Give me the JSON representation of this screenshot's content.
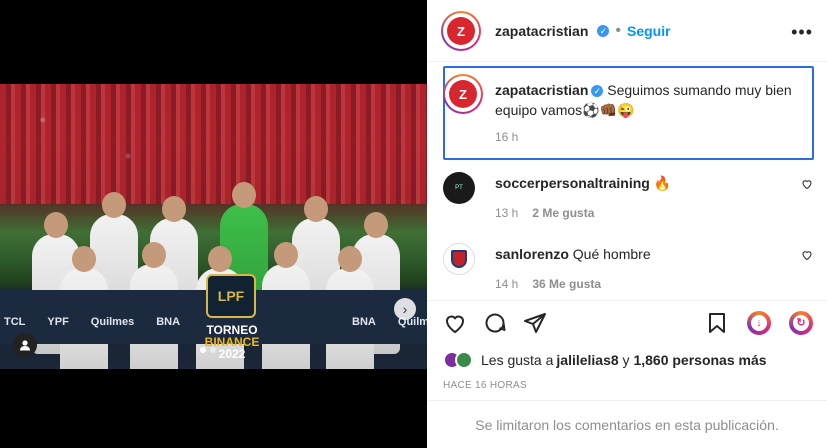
{
  "post": {
    "username": "zapatacristian",
    "follow_label": "Seguir",
    "more_icon": "•••"
  },
  "caption": {
    "username": "zapatacristian",
    "text": "Seguimos sumando muy bien equipo vamos⚽👊🏾😜",
    "time": "16 h"
  },
  "comments": [
    {
      "username": "soccerpersonaltraining",
      "text": "🔥",
      "time": "13 h",
      "likes": "2 Me gusta"
    },
    {
      "username": "sanlorenzo",
      "text": "Qué hombre",
      "time": "14 h",
      "likes": "36 Me gusta"
    }
  ],
  "likes": {
    "prefix": "Les gusta a ",
    "user": "jalilelias8",
    "middle": " y ",
    "count": "1,860 personas más"
  },
  "posted": "HACE 16 HORAS",
  "comments_limited": "Se limitaron los comentarios en esta publicación.",
  "media": {
    "banner_torneo": "TORNEO",
    "banner_binance": "BINANCE",
    "banner_year": "2022",
    "lpf": "LPF",
    "sponsor_logos": [
      "TCL",
      "YPF",
      "Quilmes",
      "BNA",
      "BNA",
      "Quilmes"
    ]
  },
  "colors": {
    "accent": "#0095f6",
    "verified": "#3897f0",
    "caption_border": "#2d6cdf",
    "brand_red": "#d8262e"
  }
}
